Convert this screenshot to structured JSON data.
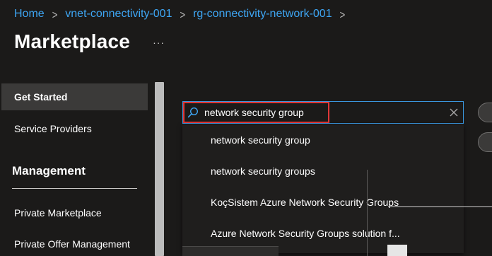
{
  "breadcrumb": {
    "items": [
      {
        "label": "Home"
      },
      {
        "label": "vnet-connectivity-001"
      },
      {
        "label": "rg-connectivity-network-001"
      }
    ],
    "separator": ">"
  },
  "header": {
    "title": "Marketplace",
    "more_label": "···"
  },
  "sidebar": {
    "items": [
      {
        "label": "Get Started",
        "active": true
      },
      {
        "label": "Service Providers",
        "active": false
      }
    ],
    "sections": [
      {
        "title": "Management",
        "items": [
          {
            "label": "Private Marketplace"
          },
          {
            "label": "Private Offer Management"
          }
        ]
      }
    ]
  },
  "search": {
    "value": "network security group",
    "placeholder": "",
    "icon": "search-icon",
    "clear_icon": "close-icon"
  },
  "suggestions": [
    {
      "label": "network security group"
    },
    {
      "label": "network security groups"
    },
    {
      "label": "KoçSistem Azure Network Security Groups"
    },
    {
      "label": "Azure Network Security Groups solution f..."
    }
  ],
  "colors": {
    "background": "#1b1a19",
    "link": "#3ea6f4",
    "focus_border": "#3a96dd",
    "highlight_border": "#e13838",
    "active_nav": "#3b3a39"
  }
}
